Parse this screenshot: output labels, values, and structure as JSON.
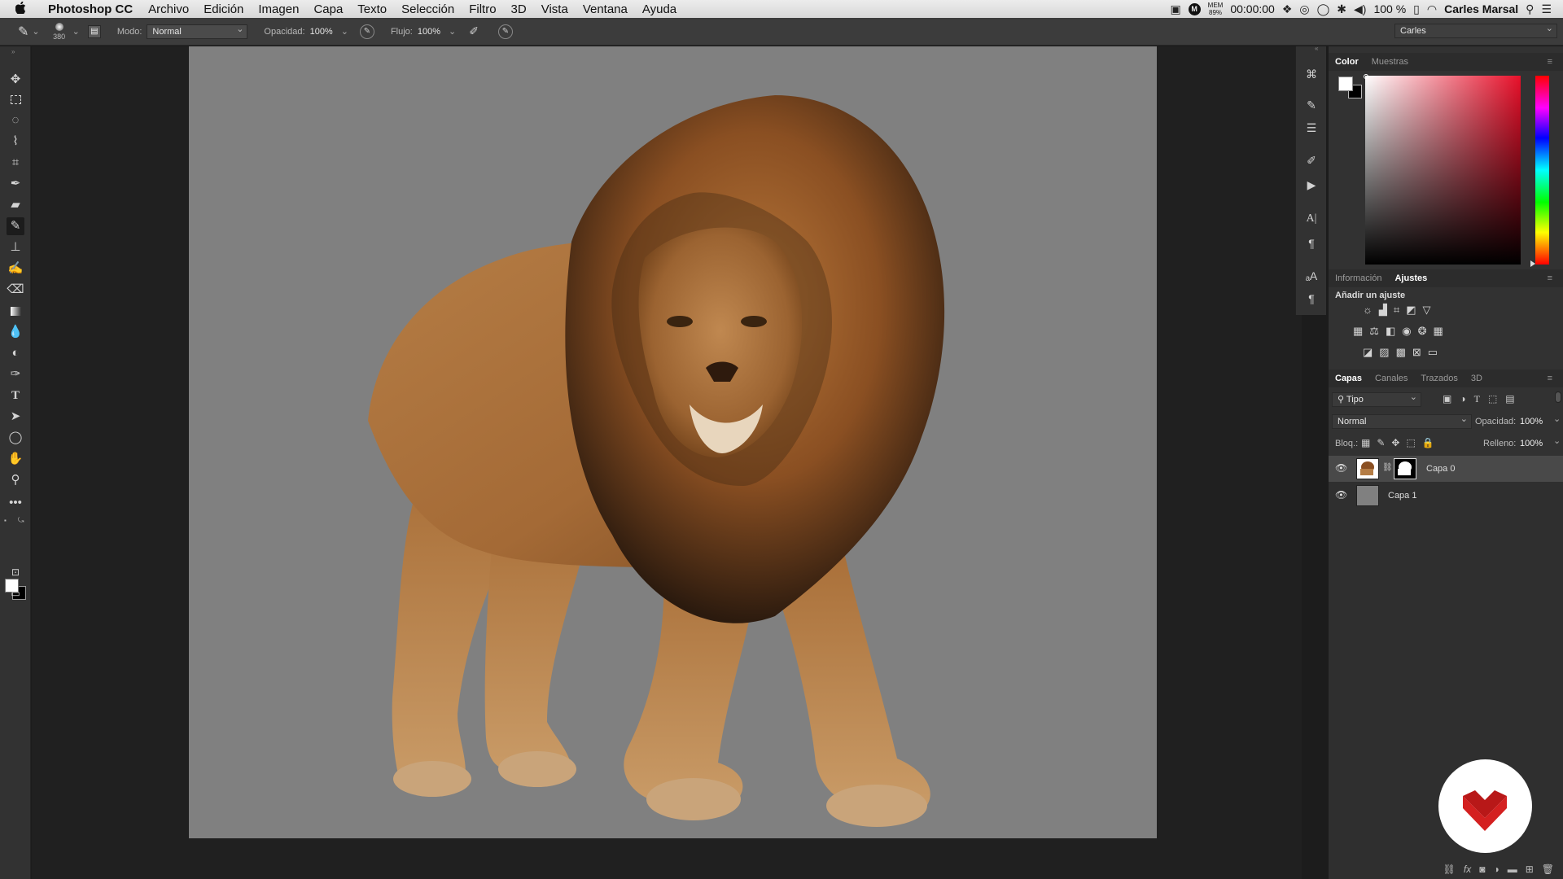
{
  "menubar": {
    "app_name": "Photoshop CC",
    "items": [
      "Archivo",
      "Edición",
      "Imagen",
      "Capa",
      "Texto",
      "Selección",
      "Filtro",
      "3D",
      "Vista",
      "Ventana",
      "Ayuda"
    ],
    "mem_label": "MEM",
    "mem_value": "89%",
    "clock": "00:00:00",
    "battery": "100 %",
    "user": "Carles Marsal"
  },
  "options": {
    "brush_size": "380",
    "mode_label": "Modo:",
    "mode_value": "Normal",
    "opacity_label": "Opacidad:",
    "opacity_value": "100%",
    "flow_label": "Flujo:",
    "flow_value": "100%",
    "workspace": "Carles"
  },
  "color_panel": {
    "tab_color": "Color",
    "tab_swatches": "Muestras",
    "hue_color": "#e8102a"
  },
  "adjust_panel": {
    "tab_info": "Información",
    "tab_adjust": "Ajustes",
    "add_label": "Añadir un ajuste"
  },
  "layers_panel": {
    "tabs": [
      "Capas",
      "Canales",
      "Trazados",
      "3D"
    ],
    "filter_kind": "Tipo",
    "blend_mode": "Normal",
    "opacity_label": "Opacidad:",
    "opacity_value": "100%",
    "lock_label": "Bloq.:",
    "fill_label": "Relleno:",
    "fill_value": "100%",
    "layers": [
      {
        "name": "Capa 0",
        "selected": true,
        "has_mask": true
      },
      {
        "name": "Capa 1",
        "selected": false,
        "has_mask": false
      }
    ]
  },
  "colors": {
    "background_gray": "#808080",
    "brand_red": "#d42020"
  }
}
